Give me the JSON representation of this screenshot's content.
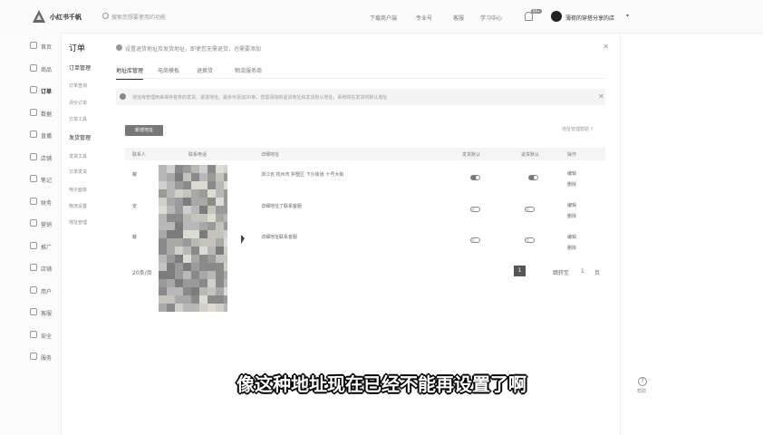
{
  "header": {
    "brand": "小红书千帆",
    "search_placeholder": "搜索您想要使用的功能",
    "links": [
      "下载商户端",
      "专业号",
      "客服",
      "学习中心"
    ],
    "notification_count": "99+",
    "username": "薄荷的穿搭分享的店"
  },
  "sidebar": {
    "items": [
      {
        "label": "首页",
        "icon": "home-icon"
      },
      {
        "label": "商品",
        "icon": "goods-icon"
      },
      {
        "label": "订单",
        "icon": "order-icon",
        "active": true
      },
      {
        "label": "数据",
        "icon": "data-icon"
      },
      {
        "label": "直播",
        "icon": "live-icon"
      },
      {
        "label": "店铺",
        "icon": "shop-icon"
      },
      {
        "label": "笔记",
        "icon": "note-icon"
      },
      {
        "label": "财务",
        "icon": "finance-icon"
      },
      {
        "label": "营销",
        "icon": "marketing-icon"
      },
      {
        "label": "推广",
        "icon": "promotion-icon"
      },
      {
        "label": "店铺",
        "icon": "store-icon"
      },
      {
        "label": "用户",
        "icon": "user-icon"
      },
      {
        "label": "客服",
        "icon": "service-icon"
      },
      {
        "label": "安全",
        "icon": "security-icon"
      },
      {
        "label": "服务",
        "icon": "services-icon"
      }
    ]
  },
  "submenu": {
    "title": "订单",
    "groups": [
      {
        "label": "订单管理",
        "items": [
          "订单查询",
          "评价订单",
          "订单工具"
        ]
      },
      {
        "label": "发货管理",
        "items": [
          "发货工具",
          "订单发货",
          "电子面单",
          "物流设置",
          "地址管理"
        ]
      }
    ]
  },
  "notice": {
    "text": "设置退货地址及发货地址，即使您无需退货，也需要添加"
  },
  "tabs": [
    "地址库管理",
    "电商模板",
    "退换货",
    "物流服务商"
  ],
  "info_banner": {
    "text": "地址库管理用来保存各类的发货、退货地址，最多可添加20条，您需添加的退货地址和发货默认地址，系统将在发货时默认地址"
  },
  "actions": {
    "add_label": "新增地址",
    "help_label": "地址管理帮助 ?"
  },
  "table": {
    "headers": [
      "联系人",
      "联系电话",
      "详细地址",
      "发货默认",
      "退货默认",
      "操作"
    ],
    "rows": [
      {
        "name": "戴",
        "address": "浙江省 杭州市 拱墅区 下沙街道 十号大街",
        "ship_default": true,
        "return_default": true,
        "ops": [
          "编辑",
          "删除"
        ]
      },
      {
        "name": "安",
        "address": "详细地址了联系客服",
        "ship_default": false,
        "return_default": false,
        "ops": [
          "编辑",
          "删除"
        ]
      },
      {
        "name": "戴",
        "address": "详细地址联系客服",
        "ship_default": false,
        "return_default": false,
        "ops": [
          "编辑",
          "删除"
        ]
      }
    ]
  },
  "pagination": {
    "total": "20条/页",
    "current_page": "1",
    "goto_label": "跳转至",
    "goto_value": "1",
    "page_unit": "页"
  },
  "subtitle": "像这种地址现在已经不能再设置了啊",
  "help_float": "帮助"
}
